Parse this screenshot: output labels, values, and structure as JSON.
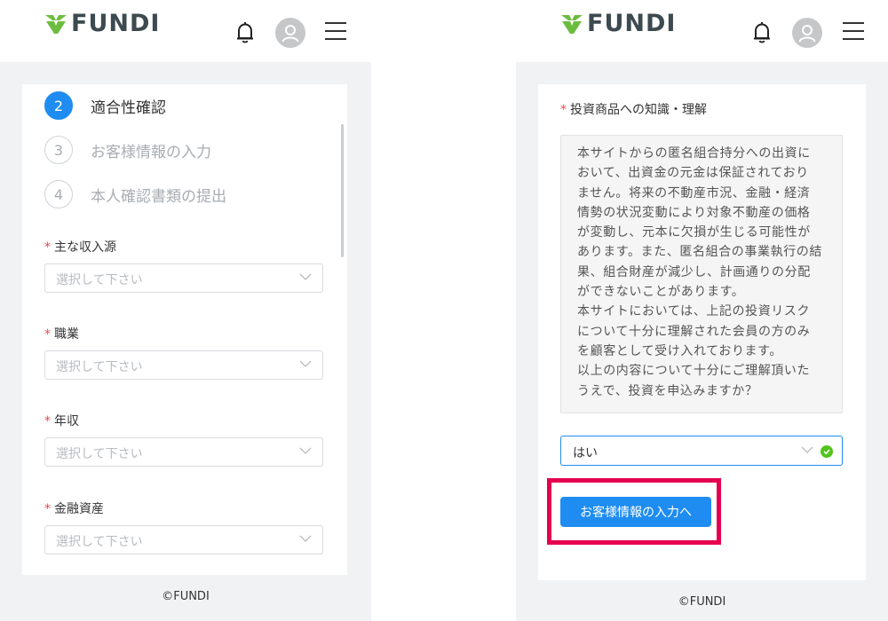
{
  "brand": {
    "name": "FUNDI",
    "logo_color": "#6cbd3f",
    "accent": "#1e8cf0",
    "highlight": "#e5004f"
  },
  "left_screen": {
    "steps": [
      {
        "number": "2",
        "label": "適合性確認",
        "active": true
      },
      {
        "number": "3",
        "label": "お客様情報の入力",
        "active": false
      },
      {
        "number": "4",
        "label": "本人確認書類の提出",
        "active": false
      }
    ],
    "fields": [
      {
        "required": "*",
        "label": "主な収入源",
        "placeholder": "選択して下さい"
      },
      {
        "required": "*",
        "label": "職業",
        "placeholder": "選択して下さい"
      },
      {
        "required": "*",
        "label": "年収",
        "placeholder": "選択して下さい"
      },
      {
        "required": "*",
        "label": "金融資産",
        "placeholder": "選択して下さい"
      }
    ],
    "footer": "©FUNDI"
  },
  "right_screen": {
    "question": {
      "required": "*",
      "label": "投資商品への知識・理解"
    },
    "notice_lines": [
      "本サイトからの匿名組合持分への出資に",
      "おいて、出資金の元金は保証されており",
      "ません。将来の不動産市況、金融・経済",
      "情勢の状況変動により対象不動産の価格",
      "が変動し、元本に欠損が生じる可能性が",
      "あります。また、匿名組合の事業執行の結",
      "果、組合財産が減少し、計画通りの分配",
      "ができないことがあります。",
      "本サイトにおいては、上記の投資リスク",
      "について十分に理解された会員の方のみ",
      "を顧客として受け入れております。",
      "以上の内容について十分にご理解頂いた",
      "うえで、投資を申込みますか？"
    ],
    "answer": "はい",
    "next_button": "お客様情報の入力へ",
    "footer": "©FUNDI"
  }
}
